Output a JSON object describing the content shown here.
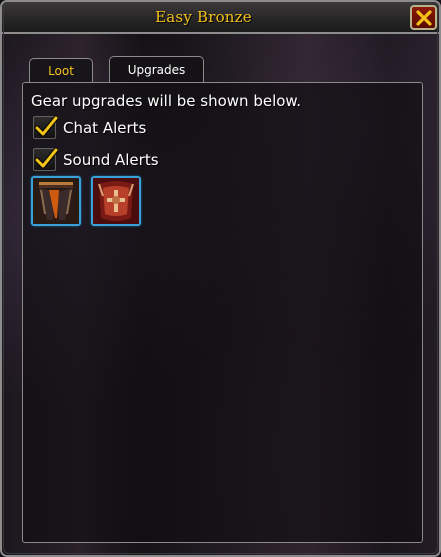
{
  "window": {
    "title": "Easy Bronze",
    "close_icon": "close-x-icon"
  },
  "tabs": [
    {
      "label": "Loot",
      "active": false,
      "color": "#f5c21b"
    },
    {
      "label": "Upgrades",
      "active": true,
      "color": "#ffffff"
    }
  ],
  "upgrades": {
    "description": "Gear upgrades will be shown below.",
    "options": [
      {
        "label": "Chat Alerts",
        "checked": true
      },
      {
        "label": "Sound Alerts",
        "checked": true
      }
    ],
    "items": [
      {
        "icon": "leg-armor-item-icon",
        "border_color": "#3aa0d8"
      },
      {
        "icon": "chest-armor-item-icon",
        "border_color": "#3aa0d8"
      }
    ]
  },
  "colors": {
    "title_gold": "#f5c21b",
    "close_red": "#8a1a08",
    "rare_blue": "#3aa0d8"
  }
}
